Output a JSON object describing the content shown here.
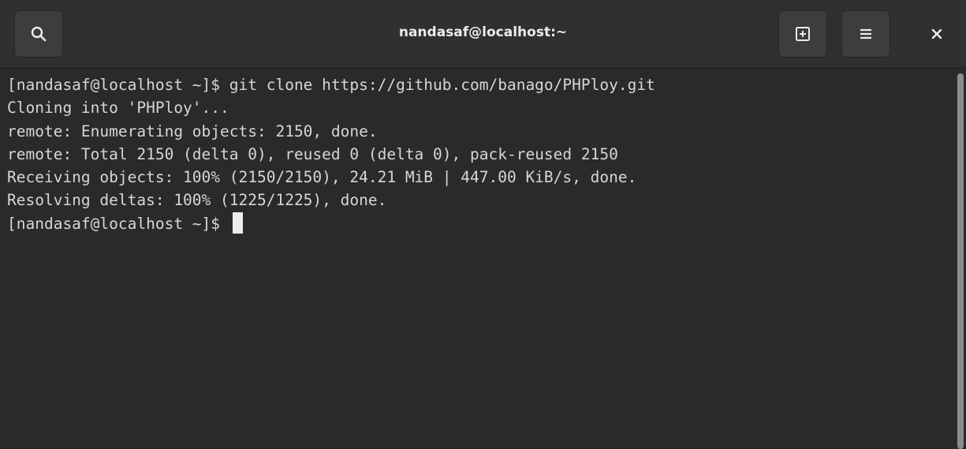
{
  "window": {
    "title": "nandasaf@localhost:~"
  },
  "headerbar": {
    "icons": {
      "search": "search-icon",
      "new_tab": "new-tab-icon",
      "menu": "hamburger-menu-icon",
      "close": "close-icon"
    }
  },
  "terminal": {
    "lines": [
      "[nandasaf@localhost ~]$ git clone https://github.com/banago/PHPloy.git",
      "Cloning into 'PHPloy'...",
      "remote: Enumerating objects: 2150, done.",
      "remote: Total 2150 (delta 0), reused 0 (delta 0), pack-reused 2150",
      "Receiving objects: 100% (2150/2150), 24.21 MiB | 447.00 KiB/s, done.",
      "Resolving deltas: 100% (1225/1225), done."
    ],
    "prompt": "[nandasaf@localhost ~]$ "
  },
  "colors": {
    "headerbar": "#303030",
    "terminal_bg": "#2a2a2a",
    "terminal_fg": "#d6d6d6",
    "cursor": "#ececec"
  }
}
